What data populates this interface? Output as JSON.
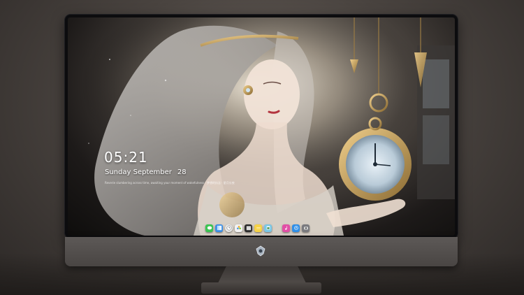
{
  "lock_screen": {
    "time": "05:21",
    "weekday_month": "Sunday September",
    "day": "28",
    "quote": "Reverie slumbering across time, awaiting your moment of wakefulness · 梦想的执念 · 星月长夜"
  },
  "dock": {
    "items": [
      {
        "name": "messages-icon",
        "color": "#3bc552"
      },
      {
        "name": "finder-icon",
        "color": "#3a8ee6"
      },
      {
        "name": "clock-icon",
        "color": "#e8e8e8"
      },
      {
        "name": "photos-icon",
        "color": "#f2f2f2"
      },
      {
        "name": "clapper-icon",
        "color": "#2b2b2b"
      },
      {
        "name": "notes-icon",
        "color": "#f6d247"
      },
      {
        "name": "preview-icon",
        "color": "#79c7e6"
      },
      {
        "name": "itunes-icon",
        "color": "#e24fa6"
      },
      {
        "name": "app-store-icon",
        "color": "#2f8fe8"
      },
      {
        "name": "camera-icon",
        "color": "#7a7a7e"
      }
    ]
  },
  "colors": {
    "bezel": "#0c0c0e",
    "chin": "#5d5957",
    "clock_text": "#ffffff"
  }
}
